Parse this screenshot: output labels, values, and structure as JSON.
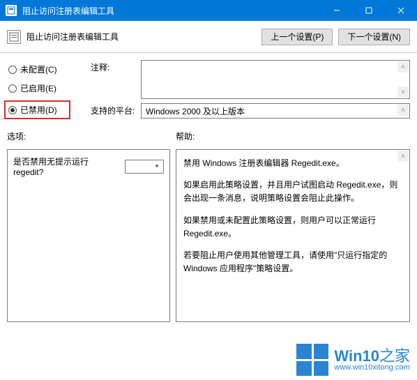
{
  "window": {
    "title": "阻止访问注册表编辑工具"
  },
  "toolbar": {
    "title": "阻止访问注册表编辑工具",
    "prev_label": "上一个设置(P)",
    "next_label": "下一个设置(N)"
  },
  "radios": {
    "not_configured": "未配置(C)",
    "enabled": "已启用(E)",
    "disabled": "已禁用(D)",
    "selected": "disabled"
  },
  "fields": {
    "comment_label": "注释:",
    "comment_value": "",
    "platform_label": "支持的平台:",
    "platform_value": "Windows 2000 及以上版本"
  },
  "sections": {
    "options_label": "选项:",
    "help_label": "帮助:"
  },
  "options": {
    "regedit_silent_label": "是否禁用无提示运行 regedit?",
    "regedit_silent_value": ""
  },
  "help": {
    "p1": "禁用 Windows 注册表编辑器 Regedit.exe。",
    "p2": "如果启用此策略设置，并且用户试图启动 Regedit.exe，则会出现一条消息，说明策略设置会阻止此操作。",
    "p3": "如果禁用或未配置此策略设置，则用户可以正常运行 Regedit.exe。",
    "p4": "若要阻止用户使用其他管理工具，请使用\"只运行指定的 Windows 应用程序\"策略设置。"
  },
  "watermark": {
    "brand_main": "Win10",
    "brand_suffix": "之家",
    "url": "www.win10xitong.com"
  }
}
